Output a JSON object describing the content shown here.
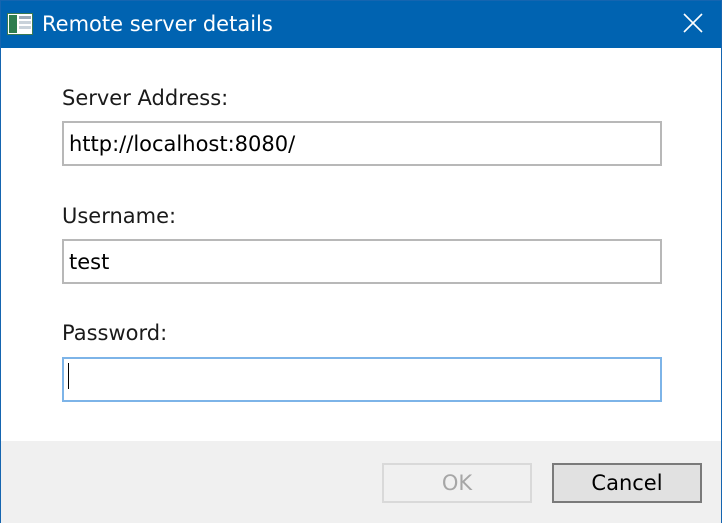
{
  "window": {
    "title": "Remote server details",
    "close_label": "Close"
  },
  "form": {
    "server_address": {
      "label": "Server Address:",
      "value": "http://localhost:8080/"
    },
    "username": {
      "label": "Username:",
      "value": "test"
    },
    "password": {
      "label": "Password:",
      "value": ""
    }
  },
  "buttons": {
    "ok_label": "OK",
    "cancel_label": "Cancel"
  },
  "colors": {
    "titlebar": "#0063b1",
    "focus_border": "#7db4e8",
    "footer_bg": "#f0f0f0"
  },
  "icons": {
    "app": "app-window-icon",
    "close": "close-icon"
  }
}
